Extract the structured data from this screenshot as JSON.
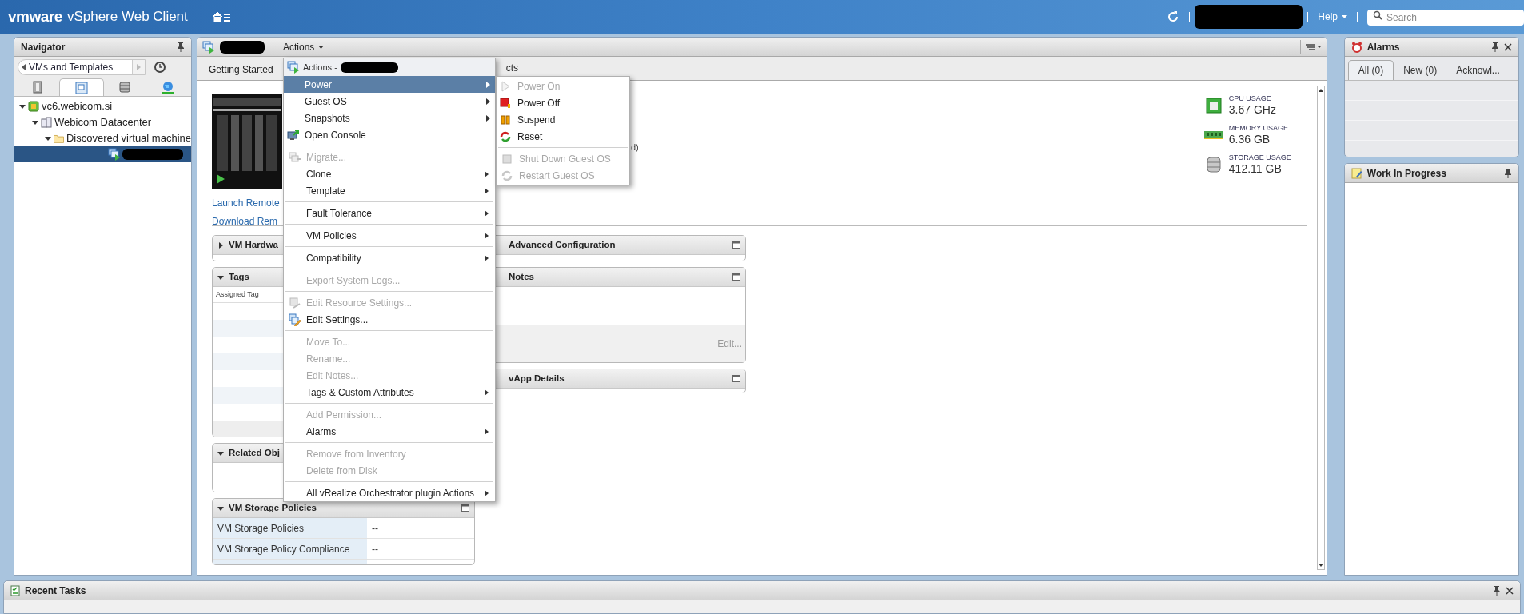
{
  "top_bar": {
    "logo": "vmware",
    "product": "vSphere Web Client",
    "help": "Help",
    "search": {
      "placeholder": "Search"
    }
  },
  "navigator": {
    "title": "Navigator",
    "breadcrumb": "VMs and Templates",
    "tabs": [
      {
        "selected": false
      },
      {
        "selected": true
      },
      {
        "selected": false
      },
      {
        "selected": false
      }
    ],
    "tree": [
      {
        "label": "vc6.webicom.si",
        "expanded": true,
        "children": [
          {
            "label": "Webicom Datacenter",
            "expanded": true,
            "children": [
              {
                "label": "Discovered virtual machine",
                "expanded": true,
                "children": [
                  {
                    "selected": true
                  }
                ]
              }
            ]
          }
        ]
      }
    ]
  },
  "center": {
    "actions_button": "Actions",
    "tabs": [
      {
        "label": "Getting Started",
        "selected": false
      },
      {
        "label": "cts",
        "selected": false
      }
    ],
    "console_links": [
      "Launch Remote",
      "Download Rem"
    ],
    "partial_text": "d)",
    "metrics": [
      {
        "label": "CPU USAGE",
        "value": "3.67 GHz"
      },
      {
        "label": "MEMORY USAGE",
        "value": "6.36 GB"
      },
      {
        "label": "STORAGE USAGE",
        "value": "412.11 GB"
      }
    ],
    "cards_left": [
      {
        "title": "VM Hardwa",
        "expanded": false
      },
      {
        "title": "Tags",
        "expanded": true,
        "column": "Assigned Tag"
      },
      {
        "title": "Related Obj",
        "expanded": true
      },
      {
        "title": "VM Storage Policies",
        "expanded": true,
        "maximizable": true,
        "rows": [
          {
            "label": "VM Storage Policies",
            "value": "--"
          },
          {
            "label": "VM Storage Policy Compliance",
            "value": "--"
          }
        ]
      }
    ],
    "cards_right": [
      {
        "title": "Advanced Configuration",
        "maximizable": true
      },
      {
        "title": "Notes",
        "maximizable": true,
        "action": "Edit..."
      },
      {
        "title": "vApp Details",
        "maximizable": true
      }
    ]
  },
  "menu": {
    "title": "Actions -",
    "groups": [
      [
        {
          "label": "Power",
          "selected": true,
          "disabled": false,
          "submenu": true
        },
        {
          "label": "Guest OS",
          "selected": false,
          "disabled": false,
          "submenu": true
        },
        {
          "label": "Snapshots",
          "selected": false,
          "disabled": false,
          "submenu": true
        },
        {
          "label": "Open Console",
          "selected": false,
          "disabled": false,
          "submenu": false
        }
      ],
      [
        {
          "label": "Migrate...",
          "selected": false,
          "disabled": true,
          "submenu": false
        },
        {
          "label": "Clone",
          "selected": false,
          "disabled": false,
          "submenu": true
        },
        {
          "label": "Template",
          "selected": false,
          "disabled": false,
          "submenu": true
        }
      ],
      [
        {
          "label": "Fault Tolerance",
          "selected": false,
          "disabled": false,
          "submenu": true
        }
      ],
      [
        {
          "label": "VM Policies",
          "selected": false,
          "disabled": false,
          "submenu": true
        }
      ],
      [
        {
          "label": "Compatibility",
          "selected": false,
          "disabled": false,
          "submenu": true
        }
      ],
      [
        {
          "label": "Export System Logs...",
          "selected": false,
          "disabled": true,
          "submenu": false
        }
      ],
      [
        {
          "label": "Edit Resource Settings...",
          "selected": false,
          "disabled": true,
          "submenu": false
        },
        {
          "label": "Edit Settings...",
          "selected": false,
          "disabled": false,
          "submenu": false
        }
      ],
      [
        {
          "label": "Move To...",
          "selected": false,
          "disabled": true,
          "submenu": false
        },
        {
          "label": "Rename...",
          "selected": false,
          "disabled": true,
          "submenu": false
        },
        {
          "label": "Edit Notes...",
          "selected": false,
          "disabled": true,
          "submenu": false
        },
        {
          "label": "Tags & Custom Attributes",
          "selected": false,
          "disabled": false,
          "submenu": true
        }
      ],
      [
        {
          "label": "Add Permission...",
          "selected": false,
          "disabled": true,
          "submenu": false
        },
        {
          "label": "Alarms",
          "selected": false,
          "disabled": false,
          "submenu": true
        }
      ],
      [
        {
          "label": "Remove from Inventory",
          "selected": false,
          "disabled": true,
          "submenu": false
        },
        {
          "label": "Delete from Disk",
          "selected": false,
          "disabled": true,
          "submenu": false
        }
      ],
      [
        {
          "label": "All vRealize Orchestrator plugin Actions",
          "selected": false,
          "disabled": false,
          "submenu": true
        }
      ]
    ]
  },
  "submenu": {
    "groups": [
      [
        {
          "label": "Power On",
          "disabled": true
        },
        {
          "label": "Power Off",
          "disabled": false
        },
        {
          "label": "Suspend",
          "disabled": false
        },
        {
          "label": "Reset",
          "disabled": false
        }
      ],
      [
        {
          "label": "Shut Down Guest OS",
          "disabled": true
        },
        {
          "label": "Restart Guest OS",
          "disabled": true
        }
      ]
    ]
  },
  "alarms": {
    "title": "Alarms",
    "tabs": [
      {
        "label": "All (0)",
        "selected": true
      },
      {
        "label": "New (0)",
        "selected": false
      },
      {
        "label": "Acknowl...",
        "selected": false
      }
    ]
  },
  "work_in_progress": {
    "title": "Work In Progress"
  },
  "recent_tasks": {
    "title": "Recent Tasks"
  }
}
